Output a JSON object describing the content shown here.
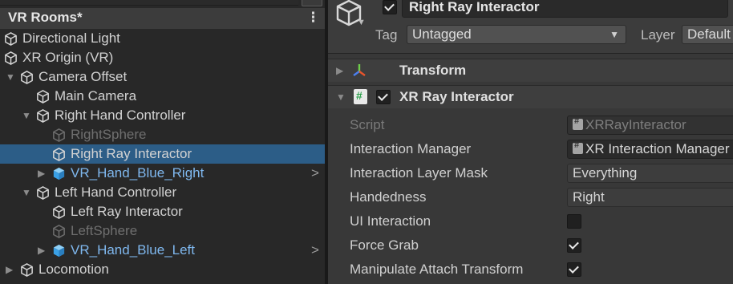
{
  "hierarchy": {
    "scene_name": "VR Rooms*",
    "scene_menu": "⋮",
    "items": [
      {
        "label": "Directional Light",
        "depth": 0,
        "fold": "",
        "state": "normal",
        "icon": "cube-outline-icon",
        "more": false
      },
      {
        "label": "XR Origin (VR)",
        "depth": 0,
        "fold": "",
        "state": "normal",
        "icon": "cube-outline-icon",
        "more": false
      },
      {
        "label": "Camera Offset",
        "depth": 0,
        "fold": "▼",
        "state": "normal",
        "icon": "cube-outline-icon",
        "more": false
      },
      {
        "label": "Main Camera",
        "depth": 1,
        "fold": "",
        "state": "normal",
        "icon": "cube-outline-icon",
        "more": false
      },
      {
        "label": "Right Hand Controller",
        "depth": 1,
        "fold": "▼",
        "state": "normal",
        "icon": "cube-outline-icon",
        "more": false
      },
      {
        "label": "RightSphere",
        "depth": 2,
        "fold": "",
        "state": "dim",
        "icon": "cube-outline-icon",
        "more": false
      },
      {
        "label": "Right Ray Interactor",
        "depth": 2,
        "fold": "",
        "state": "selected",
        "icon": "cube-outline-icon",
        "more": false
      },
      {
        "label": "VR_Hand_Blue_Right",
        "depth": 2,
        "fold": "▶",
        "state": "prefab",
        "icon": "prefab-cube-icon",
        "more": true
      },
      {
        "label": "Left Hand Controller",
        "depth": 1,
        "fold": "▼",
        "state": "normal",
        "icon": "cube-outline-icon",
        "more": false
      },
      {
        "label": "Left Ray Interactor",
        "depth": 2,
        "fold": "",
        "state": "normal",
        "icon": "cube-outline-icon",
        "more": false
      },
      {
        "label": "LeftSphere",
        "depth": 2,
        "fold": "",
        "state": "dim",
        "icon": "cube-outline-icon",
        "more": false
      },
      {
        "label": "VR_Hand_Blue_Left",
        "depth": 2,
        "fold": "▶",
        "state": "prefab",
        "icon": "prefab-cube-icon",
        "more": true
      },
      {
        "label": "Locomotion",
        "depth": 0,
        "fold": "▶",
        "state": "normal",
        "icon": "cube-outline-icon",
        "more": false
      }
    ],
    "more_glyph": ">"
  },
  "inspector": {
    "object_name": "Right Ray Interactor",
    "active": true,
    "tag_label": "Tag",
    "tag_value": "Untagged",
    "layer_label": "Layer",
    "layer_value": "Default",
    "components": {
      "transform": {
        "label": "Transform",
        "icon": "transform-axes-icon"
      },
      "xr_ray": {
        "label": "XR Ray Interactor",
        "enabled": true,
        "icon": "script-file-icon"
      }
    },
    "properties": [
      {
        "label": "Script",
        "kind": "object",
        "value": "XRRayInteractor",
        "readonly": true
      },
      {
        "label": "Interaction Manager",
        "kind": "object",
        "value": "XR Interaction Manager",
        "readonly": false
      },
      {
        "label": "Interaction Layer Mask",
        "kind": "dropdown",
        "value": "Everything"
      },
      {
        "label": "Handedness",
        "kind": "dropdown",
        "value": "Right"
      },
      {
        "label": "UI Interaction",
        "kind": "toggle",
        "value": false
      },
      {
        "label": "Force Grab",
        "kind": "toggle",
        "value": true
      },
      {
        "label": "Manipulate Attach Transform",
        "kind": "toggle",
        "value": true
      }
    ]
  },
  "colors": {
    "selection": "#2c5d87",
    "prefab_text": "#7fb8ef",
    "prefab_icon": "#4fb0ee",
    "panel_bg": "#282828",
    "inspector_bg": "#383838"
  }
}
